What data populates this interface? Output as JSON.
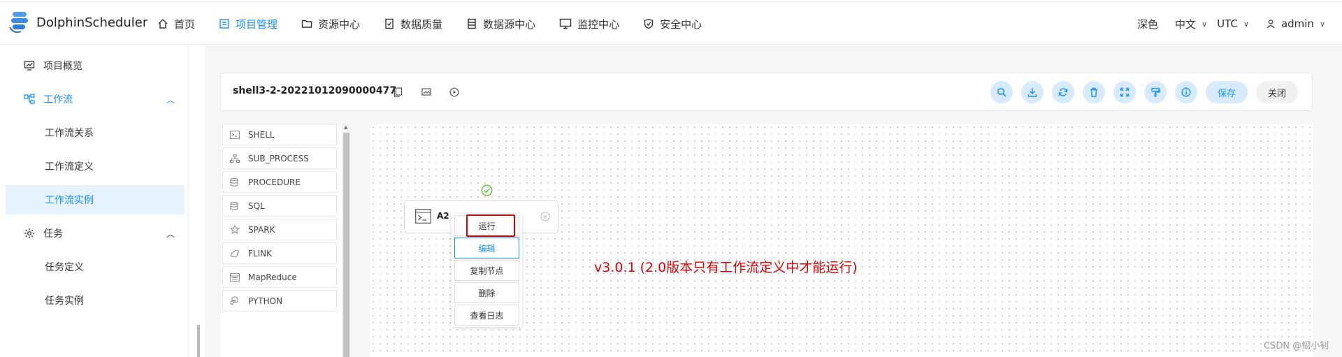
{
  "app": {
    "name": "DolphinScheduler"
  },
  "nav": {
    "items": [
      {
        "label": "首页",
        "icon": "home-icon"
      },
      {
        "label": "项目管理",
        "icon": "project-icon",
        "active": true
      },
      {
        "label": "资源中心",
        "icon": "folder-icon"
      },
      {
        "label": "数据质量",
        "icon": "document-check-icon"
      },
      {
        "label": "数据源中心",
        "icon": "database-icon"
      },
      {
        "label": "监控中心",
        "icon": "monitor-icon"
      },
      {
        "label": "安全中心",
        "icon": "shield-icon"
      }
    ],
    "theme": "深色",
    "language": "中文",
    "timezone": "UTC",
    "user": "admin"
  },
  "sidebar": {
    "overview": "项目概览",
    "workflow": "工作流",
    "workflow_children": [
      "工作流关系",
      "工作流定义",
      "工作流实例"
    ],
    "active_child": "工作流实例",
    "task": "任务",
    "task_children": [
      "任务定义",
      "任务实例"
    ]
  },
  "toolbar": {
    "workflow_name": "shell3-2-20221012090000477",
    "icons": [
      "search-icon",
      "download-icon",
      "refresh-icon",
      "delete-icon",
      "fullscreen-icon",
      "format-icon",
      "info-icon"
    ],
    "save": "保存",
    "close": "关闭"
  },
  "task_types": [
    "SHELL",
    "SUB_PROCESS",
    "PROCEDURE",
    "SQL",
    "SPARK",
    "FLINK",
    "MapReduce",
    "PYTHON"
  ],
  "node": {
    "name": "A2",
    "status": "success"
  },
  "context_menu": [
    "运行",
    "编辑",
    "复制节点",
    "删除",
    "查看日志"
  ],
  "annotation": "v3.0.1 (2.0版本只有工作流定义中才能运行)",
  "watermark": "CSDN @韧小钊",
  "colors": {
    "accent": "#1890ff",
    "highlight": "#e30000",
    "success": "#52c41a"
  }
}
